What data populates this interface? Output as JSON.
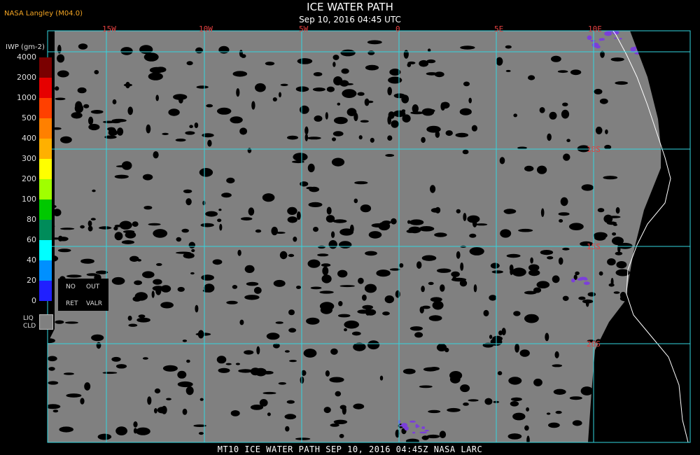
{
  "header": {
    "credit": "NASA Langley (M04.0)",
    "title": "ICE WATER PATH",
    "subtitle": "Sep 10, 2016 04:45 UTC"
  },
  "footer": {
    "text": "MT10  ICE WATER PATH  SEP 10, 2016 04:45Z  NASA LARC"
  },
  "colors": {
    "cloud_gray": "#808080",
    "clear_black": "#000000",
    "grid": "#33d6e0",
    "coast": "#ffffff",
    "label_red": "#e34040",
    "credit_orange": "#f5a623",
    "ice_purple": "#7b3fd9"
  },
  "scale": {
    "units": "IWP (gm-2)",
    "levels": [
      {
        "value": "4000",
        "color": "#7a0000"
      },
      {
        "value": "2000",
        "color": "#e60000"
      },
      {
        "value": "1000",
        "color": "#ff4000"
      },
      {
        "value": "500",
        "color": "#ff8000"
      },
      {
        "value": "400",
        "color": "#ffb000"
      },
      {
        "value": "300",
        "color": "#ffff00"
      },
      {
        "value": "200",
        "color": "#a0ff00"
      },
      {
        "value": "100",
        "color": "#00c800"
      },
      {
        "value": "80",
        "color": "#008c5a"
      },
      {
        "value": "60",
        "color": "#00ffff"
      },
      {
        "value": "40",
        "color": "#0090ff"
      },
      {
        "value": "20",
        "color": "#2020ff"
      },
      {
        "value": "0",
        "color": "#7b3fd9"
      }
    ],
    "no_label": "NO",
    "out_label": "OUT",
    "ret_label": "RET",
    "valr_label": "VALR",
    "liq_label": "LIQ",
    "cld_label": "CLD"
  },
  "grid_labels": {
    "lon": [
      "15W",
      "10W",
      "5W",
      "0",
      "5E",
      "10E"
    ],
    "lat": [
      "10S",
      "15S",
      "20S"
    ]
  }
}
